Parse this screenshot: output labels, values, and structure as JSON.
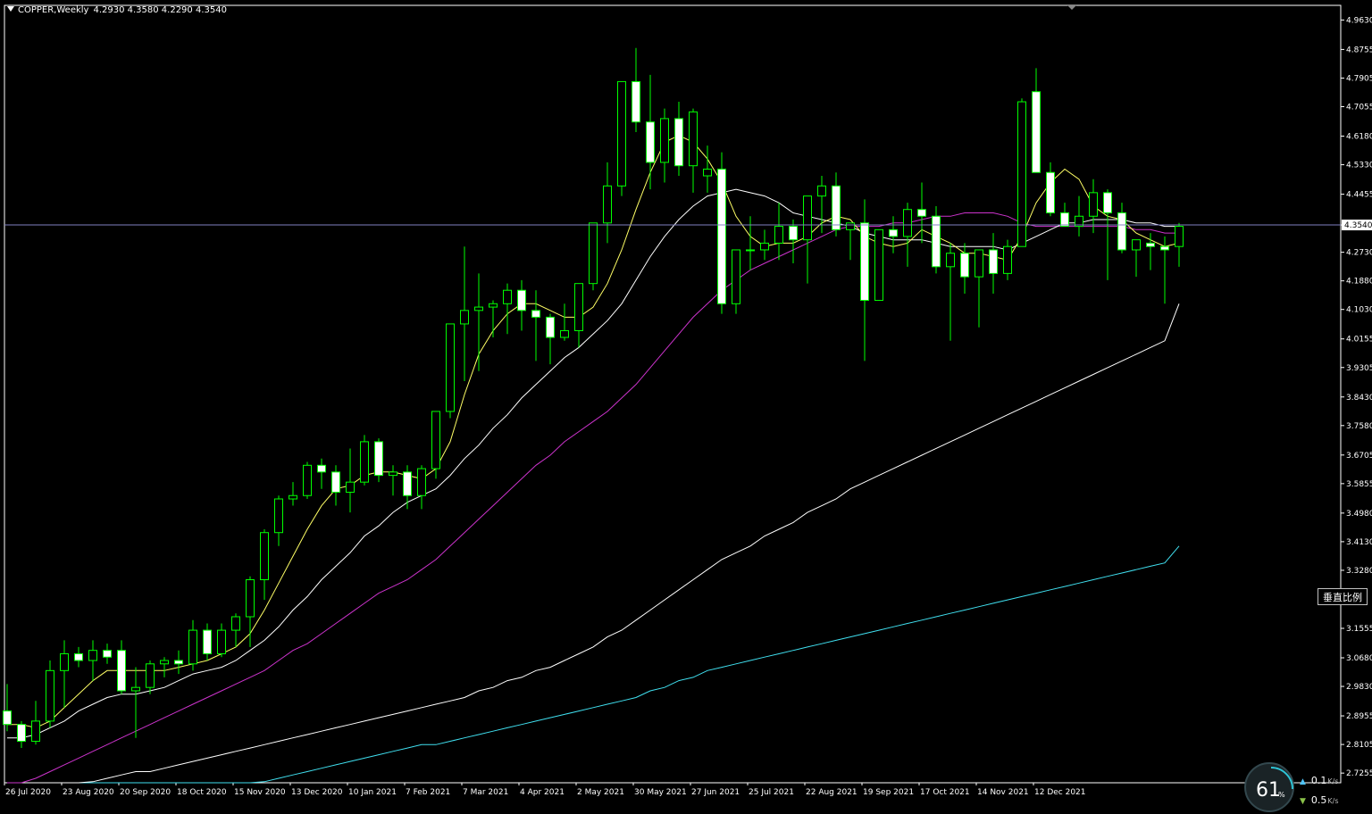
{
  "header": {
    "symbol": "COPPER,Weekly",
    "quote": "4.2930 4.3580 4.2290 4.3540"
  },
  "vscale_button": "垂直比例",
  "net_widget": {
    "cpu_value": "61",
    "cpu_unit": "%",
    "upload": "0.1",
    "upload_unit": "K/s",
    "download": "0.5",
    "download_unit": "K/s"
  },
  "colors": {
    "background": "#000000",
    "bull_candle": "#00ff00",
    "bear_candle": "#ffffff",
    "ma_fast": "#ffff66",
    "ma_mid": "#ffffff",
    "ma_slow": "#cc33cc",
    "ma_long": "#ffffff",
    "ma_longest": "#40e0f0",
    "price_line": "#8080c0",
    "axis": "#ffffff"
  },
  "chart_data": {
    "type": "candlestick",
    "title": "COPPER,Weekly",
    "current_price": 4.354,
    "ylim": [
      2.71,
      4.98
    ],
    "y_ticks": [
      "4.9630",
      "4.8755",
      "4.7905",
      "4.7055",
      "4.6180",
      "4.5330",
      "4.4455",
      "4.3540",
      "4.2730",
      "4.1880",
      "4.1030",
      "4.0155",
      "3.9305",
      "3.8430",
      "3.7580",
      "3.6705",
      "3.5855",
      "3.4980",
      "3.4130",
      "3.3280",
      "3.1555",
      "3.0680",
      "2.9830",
      "2.8955",
      "2.8105",
      "2.7255"
    ],
    "x_labels": [
      "26 Jul 2020",
      "23 Aug 2020",
      "20 Sep 2020",
      "18 Oct 2020",
      "15 Nov 2020",
      "13 Dec 2020",
      "10 Jan 2021",
      "7 Feb 2021",
      "7 Mar 2021",
      "4 Apr 2021",
      "2 May 2021",
      "30 May 2021",
      "27 Jun 2021",
      "25 Jul 2021",
      "22 Aug 2021",
      "19 Sep 2021",
      "17 Oct 2021",
      "14 Nov 2021",
      "12 Dec 2021"
    ],
    "ohlc": [
      [
        2.91,
        2.99,
        2.85,
        2.87
      ],
      [
        2.87,
        2.88,
        2.8,
        2.82
      ],
      [
        2.82,
        2.94,
        2.81,
        2.88
      ],
      [
        2.88,
        3.06,
        2.86,
        3.03
      ],
      [
        3.03,
        3.12,
        2.92,
        3.08
      ],
      [
        3.08,
        3.1,
        3.04,
        3.06
      ],
      [
        3.06,
        3.12,
        3.0,
        3.09
      ],
      [
        3.09,
        3.11,
        3.05,
        3.07
      ],
      [
        3.09,
        3.12,
        2.96,
        2.97
      ],
      [
        2.97,
        3.04,
        2.83,
        2.98
      ],
      [
        2.98,
        3.06,
        2.96,
        3.05
      ],
      [
        3.05,
        3.07,
        3.01,
        3.06
      ],
      [
        3.06,
        3.09,
        3.02,
        3.05
      ],
      [
        3.05,
        3.18,
        3.03,
        3.15
      ],
      [
        3.15,
        3.17,
        3.06,
        3.08
      ],
      [
        3.08,
        3.17,
        3.07,
        3.15
      ],
      [
        3.15,
        3.2,
        3.1,
        3.19
      ],
      [
        3.19,
        3.31,
        3.1,
        3.3
      ],
      [
        3.3,
        3.45,
        3.24,
        3.44
      ],
      [
        3.44,
        3.55,
        3.4,
        3.54
      ],
      [
        3.54,
        3.59,
        3.52,
        3.55
      ],
      [
        3.55,
        3.65,
        3.54,
        3.64
      ],
      [
        3.64,
        3.66,
        3.57,
        3.62
      ],
      [
        3.62,
        3.64,
        3.52,
        3.56
      ],
      [
        3.56,
        3.69,
        3.5,
        3.59
      ],
      [
        3.59,
        3.73,
        3.58,
        3.71
      ],
      [
        3.71,
        3.72,
        3.59,
        3.61
      ],
      [
        3.61,
        3.64,
        3.55,
        3.62
      ],
      [
        3.62,
        3.64,
        3.51,
        3.55
      ],
      [
        3.55,
        3.64,
        3.51,
        3.63
      ],
      [
        3.63,
        3.8,
        3.6,
        3.8
      ],
      [
        3.8,
        4.06,
        3.78,
        4.06
      ],
      [
        4.06,
        4.29,
        3.89,
        4.1
      ],
      [
        4.1,
        4.21,
        3.92,
        4.11
      ],
      [
        4.11,
        4.13,
        4.02,
        4.12
      ],
      [
        4.12,
        4.18,
        4.03,
        4.16
      ],
      [
        4.16,
        4.19,
        4.04,
        4.1
      ],
      [
        4.1,
        4.16,
        3.95,
        4.08
      ],
      [
        4.08,
        4.09,
        3.94,
        4.02
      ],
      [
        4.02,
        4.12,
        4.01,
        4.04
      ],
      [
        4.04,
        4.18,
        3.99,
        4.18
      ],
      [
        4.18,
        4.36,
        4.16,
        4.36
      ],
      [
        4.36,
        4.54,
        4.3,
        4.47
      ],
      [
        4.47,
        4.78,
        4.44,
        4.78
      ],
      [
        4.78,
        4.88,
        4.63,
        4.66
      ],
      [
        4.66,
        4.8,
        4.46,
        4.54
      ],
      [
        4.54,
        4.7,
        4.48,
        4.67
      ],
      [
        4.67,
        4.72,
        4.5,
        4.53
      ],
      [
        4.53,
        4.7,
        4.45,
        4.69
      ],
      [
        4.5,
        4.59,
        4.45,
        4.52
      ],
      [
        4.52,
        4.57,
        4.09,
        4.12
      ],
      [
        4.12,
        4.28,
        4.09,
        4.28
      ],
      [
        4.28,
        4.38,
        4.22,
        4.28
      ],
      [
        4.28,
        4.34,
        4.25,
        4.3
      ],
      [
        4.3,
        4.42,
        4.25,
        4.35
      ],
      [
        4.35,
        4.37,
        4.24,
        4.31
      ],
      [
        4.31,
        4.44,
        4.18,
        4.44
      ],
      [
        4.44,
        4.5,
        4.33,
        4.47
      ],
      [
        4.47,
        4.51,
        4.32,
        4.34
      ],
      [
        4.34,
        4.36,
        4.25,
        4.36
      ],
      [
        4.36,
        4.43,
        3.95,
        4.13
      ],
      [
        4.13,
        4.34,
        4.13,
        4.34
      ],
      [
        4.34,
        4.38,
        4.27,
        4.32
      ],
      [
        4.32,
        4.42,
        4.23,
        4.4
      ],
      [
        4.4,
        4.48,
        4.3,
        4.38
      ],
      [
        4.38,
        4.41,
        4.21,
        4.23
      ],
      [
        4.23,
        4.3,
        4.01,
        4.27
      ],
      [
        4.27,
        4.3,
        4.15,
        4.2
      ],
      [
        4.2,
        4.28,
        4.05,
        4.28
      ],
      [
        4.28,
        4.33,
        4.15,
        4.21
      ],
      [
        4.21,
        4.31,
        4.19,
        4.29
      ],
      [
        4.29,
        4.73,
        4.29,
        4.72
      ],
      [
        4.75,
        4.82,
        4.51,
        4.51
      ],
      [
        4.51,
        4.54,
        4.38,
        4.39
      ],
      [
        4.39,
        4.42,
        4.35,
        4.35
      ],
      [
        4.35,
        4.44,
        4.32,
        4.38
      ],
      [
        4.38,
        4.49,
        4.33,
        4.45
      ],
      [
        4.45,
        4.46,
        4.19,
        4.39
      ],
      [
        4.39,
        4.42,
        4.27,
        4.28
      ],
      [
        4.28,
        4.3,
        4.2,
        4.31
      ],
      [
        4.3,
        4.33,
        4.22,
        4.29
      ],
      [
        4.29,
        4.32,
        4.12,
        4.28
      ],
      [
        4.29,
        4.36,
        4.23,
        4.35
      ]
    ],
    "ma_fast_values": [
      2.87,
      2.87,
      2.86,
      2.88,
      2.92,
      2.96,
      3.0,
      3.03,
      3.03,
      3.03,
      3.03,
      3.03,
      3.04,
      3.05,
      3.06,
      3.08,
      3.1,
      3.14,
      3.21,
      3.29,
      3.37,
      3.45,
      3.52,
      3.57,
      3.58,
      3.61,
      3.62,
      3.62,
      3.61,
      3.6,
      3.63,
      3.71,
      3.85,
      3.97,
      4.04,
      4.09,
      4.12,
      4.12,
      4.1,
      4.08,
      4.08,
      4.11,
      4.18,
      4.28,
      4.4,
      4.51,
      4.6,
      4.62,
      4.6,
      4.55,
      4.48,
      4.38,
      4.32,
      4.29,
      4.3,
      4.3,
      4.32,
      4.36,
      4.38,
      4.37,
      4.32,
      4.3,
      4.29,
      4.3,
      4.34,
      4.32,
      4.3,
      4.27,
      4.27,
      4.26,
      4.25,
      4.32,
      4.42,
      4.48,
      4.52,
      4.49,
      4.41,
      4.38,
      4.37,
      4.33,
      4.31,
      4.29,
      4.3
    ],
    "ma_mid_values": [
      2.83,
      2.83,
      2.84,
      2.86,
      2.88,
      2.91,
      2.93,
      2.95,
      2.96,
      2.96,
      2.97,
      2.98,
      3.0,
      3.02,
      3.03,
      3.04,
      3.06,
      3.09,
      3.12,
      3.16,
      3.21,
      3.25,
      3.3,
      3.34,
      3.38,
      3.43,
      3.46,
      3.5,
      3.53,
      3.55,
      3.57,
      3.61,
      3.66,
      3.7,
      3.75,
      3.79,
      3.84,
      3.88,
      3.92,
      3.96,
      3.99,
      4.03,
      4.07,
      4.12,
      4.19,
      4.26,
      4.32,
      4.37,
      4.41,
      4.44,
      4.45,
      4.46,
      4.45,
      4.44,
      4.42,
      4.39,
      4.38,
      4.37,
      4.36,
      4.35,
      4.33,
      4.32,
      4.31,
      4.31,
      4.31,
      4.3,
      4.29,
      4.29,
      4.29,
      4.29,
      4.28,
      4.3,
      4.32,
      4.34,
      4.36,
      4.36,
      4.37,
      4.37,
      4.37,
      4.36,
      4.36,
      4.35,
      4.35
    ],
    "ma_slow_values": [
      2.68,
      2.69,
      2.71,
      2.73,
      2.75,
      2.77,
      2.79,
      2.81,
      2.83,
      2.85,
      2.87,
      2.89,
      2.91,
      2.93,
      2.95,
      2.97,
      2.99,
      3.01,
      3.03,
      3.06,
      3.09,
      3.11,
      3.14,
      3.17,
      3.2,
      3.23,
      3.26,
      3.28,
      3.3,
      3.33,
      3.36,
      3.4,
      3.44,
      3.48,
      3.52,
      3.56,
      3.6,
      3.64,
      3.67,
      3.71,
      3.74,
      3.77,
      3.8,
      3.84,
      3.88,
      3.93,
      3.98,
      4.03,
      4.08,
      4.12,
      4.16,
      4.19,
      4.22,
      4.24,
      4.26,
      4.28,
      4.3,
      4.32,
      4.34,
      4.35,
      4.35,
      4.35,
      4.36,
      4.36,
      4.37,
      4.38,
      4.38,
      4.39,
      4.39,
      4.39,
      4.38,
      4.36,
      4.35,
      4.35,
      4.35,
      4.35,
      4.35,
      4.35,
      4.35,
      4.34,
      4.34,
      4.33,
      4.33
    ],
    "ma_long_values": [
      2.64,
      2.65,
      2.66,
      2.67,
      2.68,
      2.69,
      2.7,
      2.71,
      2.72,
      2.73,
      2.73,
      2.74,
      2.75,
      2.76,
      2.77,
      2.78,
      2.79,
      2.8,
      2.81,
      2.82,
      2.83,
      2.84,
      2.85,
      2.86,
      2.87,
      2.88,
      2.89,
      2.9,
      2.91,
      2.92,
      2.93,
      2.94,
      2.95,
      2.97,
      2.98,
      3.0,
      3.01,
      3.03,
      3.04,
      3.06,
      3.08,
      3.1,
      3.13,
      3.15,
      3.18,
      3.21,
      3.24,
      3.27,
      3.3,
      3.33,
      3.36,
      3.38,
      3.4,
      3.43,
      3.45,
      3.47,
      3.5,
      3.52,
      3.54,
      3.57,
      3.59,
      3.61,
      3.63,
      3.65,
      3.67,
      3.69,
      3.71,
      3.73,
      3.75,
      3.77,
      3.79,
      3.81,
      3.83,
      3.85,
      3.87,
      3.89,
      3.91,
      3.93,
      3.95,
      3.97,
      3.99,
      4.01,
      4.12
    ],
    "ma_longest_values": [
      2.6,
      2.61,
      2.61,
      2.62,
      2.63,
      2.63,
      2.64,
      2.64,
      2.65,
      2.65,
      2.66,
      2.66,
      2.67,
      2.67,
      2.68,
      2.68,
      2.69,
      2.69,
      2.7,
      2.71,
      2.72,
      2.73,
      2.74,
      2.75,
      2.76,
      2.77,
      2.78,
      2.79,
      2.8,
      2.81,
      2.81,
      2.82,
      2.83,
      2.84,
      2.85,
      2.86,
      2.87,
      2.88,
      2.89,
      2.9,
      2.91,
      2.92,
      2.93,
      2.94,
      2.95,
      2.97,
      2.98,
      3.0,
      3.01,
      3.03,
      3.04,
      3.05,
      3.06,
      3.07,
      3.08,
      3.09,
      3.1,
      3.11,
      3.12,
      3.13,
      3.14,
      3.15,
      3.16,
      3.17,
      3.18,
      3.19,
      3.2,
      3.21,
      3.22,
      3.23,
      3.24,
      3.25,
      3.26,
      3.27,
      3.28,
      3.29,
      3.3,
      3.31,
      3.32,
      3.33,
      3.34,
      3.35,
      3.4
    ]
  }
}
